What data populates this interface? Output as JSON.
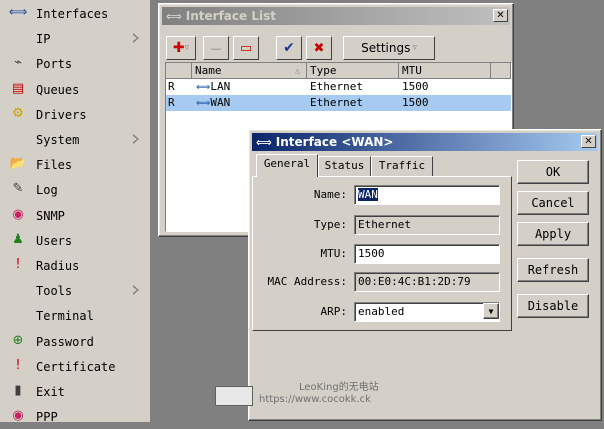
{
  "sidebar": {
    "items": [
      {
        "label": "Interfaces",
        "icon": "interfaces-icon",
        "glyph": "⟺",
        "color": "#1a4fa0",
        "submenu": false
      },
      {
        "label": "IP",
        "icon": "",
        "glyph": "",
        "color": "#000000",
        "submenu": true
      },
      {
        "label": "Ports",
        "icon": "ports-icon",
        "glyph": "⌁",
        "color": "#404040",
        "submenu": false
      },
      {
        "label": "Queues",
        "icon": "queues-icon",
        "glyph": "▤",
        "color": "#cc0000",
        "submenu": false
      },
      {
        "label": "Drivers",
        "icon": "drivers-icon",
        "glyph": "⚙",
        "color": "#c8a000",
        "submenu": false
      },
      {
        "label": "System",
        "icon": "",
        "glyph": "",
        "color": "#000000",
        "submenu": true
      },
      {
        "label": "Files",
        "icon": "files-icon",
        "glyph": "📂",
        "color": "#e0a000",
        "submenu": false
      },
      {
        "label": "Log",
        "icon": "log-icon",
        "glyph": "✎",
        "color": "#404040",
        "submenu": false
      },
      {
        "label": "SNMP",
        "icon": "snmp-icon",
        "glyph": "◉",
        "color": "#cc2060",
        "submenu": false
      },
      {
        "label": "Users",
        "icon": "users-icon",
        "glyph": "♟",
        "color": "#208020",
        "submenu": false
      },
      {
        "label": "Radius",
        "icon": "radius-icon",
        "glyph": "!",
        "color": "#cc0000",
        "submenu": false
      },
      {
        "label": "Tools",
        "icon": "",
        "glyph": "",
        "color": "#000000",
        "submenu": true
      },
      {
        "label": "Terminal",
        "icon": "",
        "glyph": "",
        "color": "#000000",
        "submenu": false
      },
      {
        "label": "Password",
        "icon": "password-icon",
        "glyph": "⊕",
        "color": "#208020",
        "submenu": false
      },
      {
        "label": "Certificate",
        "icon": "certificate-icon",
        "glyph": "!",
        "color": "#cc0000",
        "submenu": false
      },
      {
        "label": "Exit",
        "icon": "exit-icon",
        "glyph": "▮",
        "color": "#404040",
        "submenu": false
      },
      {
        "label": "PPP",
        "icon": "ppp-icon",
        "glyph": "◉",
        "color": "#cc2060",
        "submenu": false
      }
    ]
  },
  "interface_list": {
    "title": "Interface List",
    "close": "✕",
    "toolbar": {
      "add": "✚",
      "add_arrow": "▿",
      "disable": "—",
      "comment": "▭",
      "enable": "✔",
      "remove": "✖",
      "settings_label": "Settings",
      "settings_arrow": "▿"
    },
    "columns": [
      "",
      "Name",
      "Type",
      "MTU"
    ],
    "sort_arrow": "△",
    "rows": [
      {
        "flag": "R",
        "name": "LAN",
        "type": "Ethernet",
        "mtu": "1500",
        "selected": false
      },
      {
        "flag": "R",
        "name": "WAN",
        "type": "Ethernet",
        "mtu": "1500",
        "selected": true
      }
    ]
  },
  "interface_dialog": {
    "title": "Interface <WAN>",
    "close": "✕",
    "tabs": [
      "General",
      "Status",
      "Traffic"
    ],
    "active_tab": "General",
    "fields": {
      "name_label": "Name:",
      "name_value": "WAN",
      "type_label": "Type:",
      "type_value": "Ethernet",
      "mtu_label": "MTU:",
      "mtu_value": "1500",
      "mac_label": "MAC Address:",
      "mac_value": "00:E0:4C:B1:2D:79",
      "arp_label": "ARP:",
      "arp_value": "enabled",
      "arp_arrow": "▼"
    },
    "buttons": {
      "ok": "OK",
      "cancel": "Cancel",
      "apply": "Apply",
      "refresh": "Refresh",
      "disable": "Disable"
    }
  },
  "watermark": {
    "line1": "LeoKing的无电站",
    "line2": "https://www.cocokk.ck"
  },
  "colors": {
    "selection": "#a6caf0",
    "active_title": "#0a246a",
    "inactive_title": "#808080"
  }
}
